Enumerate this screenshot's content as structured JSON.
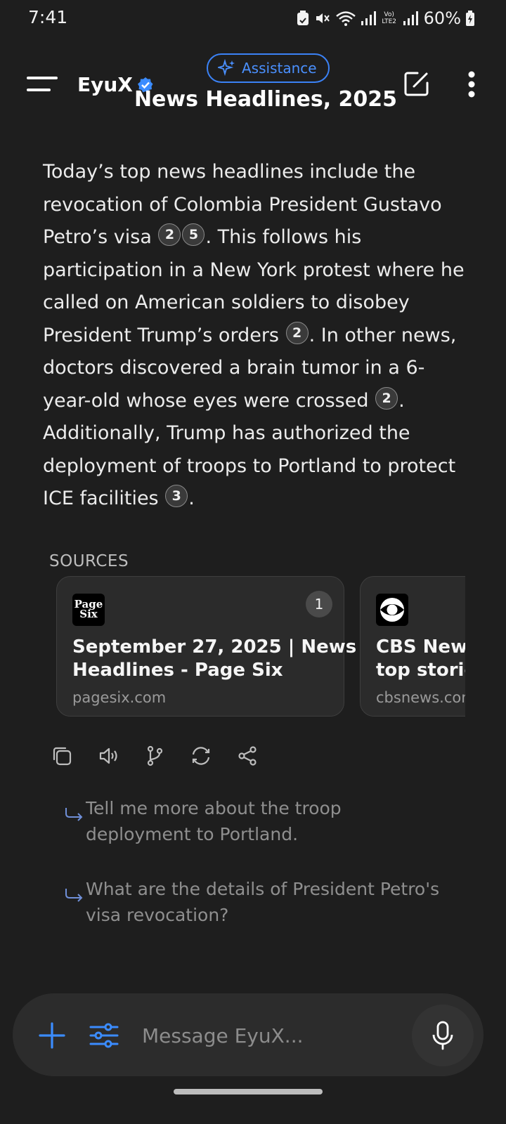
{
  "status_bar": {
    "time": "7:41",
    "battery": "60%",
    "network_label": "Vo) LTE2"
  },
  "app_bar": {
    "brand": "EyuX",
    "assistance_label": "Assistance",
    "title": "News Headlines, 2025"
  },
  "answer": {
    "parts": [
      "Today’s top news headlines include the revocation of Colombia President Gustavo Petro’s visa",
      ". This follows his participation in a New York protest where he called on American soldiers to disobey President Trump’s orders",
      ". In other news, doctors discovered a brain tumor in a 6-year-old whose eyes were crossed",
      ". Additionally, Trump has authorized the deployment of troops to Portland to protect ICE facilities",
      "."
    ],
    "citations": [
      "2",
      "5",
      "2",
      "2",
      "3"
    ]
  },
  "sources": {
    "label": "SOURCES",
    "cards": [
      {
        "number": "1",
        "logo_text": "Page Six",
        "title_line1": "September 27, 2025 | News",
        "title_line2": "Headlines - Page Six",
        "domain": "pagesix.com"
      },
      {
        "title_line1": "CBS News",
        "title_line2": "top stories",
        "domain": "cbsnews.com"
      }
    ]
  },
  "actions": [
    "copy-icon",
    "speaker-icon",
    "branch-icon",
    "regenerate-icon",
    "share-icon"
  ],
  "suggestions": [
    "Tell me more about the troop deployment to Portland.",
    "What are the details of President Petro's visa revocation?"
  ],
  "composer": {
    "placeholder": "Message EyuX..."
  },
  "colors": {
    "background": "#1e1e1e",
    "accent": "#3b82f6"
  }
}
